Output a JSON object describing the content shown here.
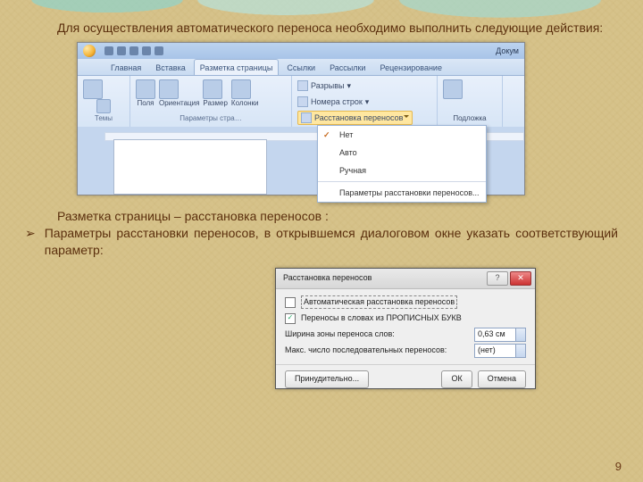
{
  "intro": "Для осуществления автоматического переноса необходимо выполнить следующие действия:",
  "section_line": "Разметка страницы – расстановка переносов :",
  "bullet_marker": "➢",
  "bullet_text": "Параметры расстановки переносов, в открывшемся диалоговом окне указать соответствующий параметр:",
  "page_number": "9",
  "word": {
    "doc_label": "Докум",
    "tabs": {
      "home": "Главная",
      "insert": "Вставка",
      "layout": "Разметка страницы",
      "refs": "Ссылки",
      "mail": "Рассылки",
      "review": "Рецензирование"
    },
    "groups": {
      "themes_btn": "Темы",
      "themes_label": "Темы",
      "margins": "Поля",
      "orientation": "Ориентация",
      "size": "Размер",
      "columns": "Колонки",
      "page_params_label": "Параметры стра…",
      "breaks": "Разрывы",
      "line_numbers": "Номера строк",
      "hyphenation": "Расстановка переносов",
      "watermark": "Подложка"
    },
    "menu": {
      "none": "Нет",
      "auto": "Авто",
      "manual": "Ручная",
      "options": "Параметры расстановки переносов..."
    }
  },
  "dialog": {
    "title": "Расстановка переносов",
    "auto_hyph": "Автоматическая расстановка переносов",
    "caps": "Переносы в словах из ПРОПИСНЫХ БУКВ",
    "zone_label": "Ширина зоны переноса слов:",
    "zone_value": "0,63 см",
    "limit_label": "Макс. число последовательных переносов:",
    "limit_value": "(нет)",
    "force": "Принудительно...",
    "ok": "ОК",
    "cancel": "Отмена"
  }
}
